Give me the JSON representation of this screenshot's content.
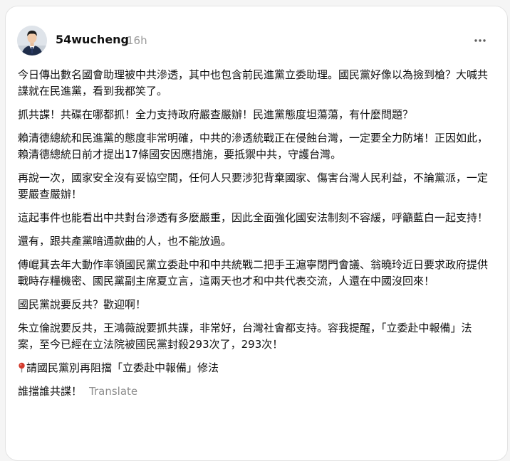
{
  "post": {
    "username": "54wucheng",
    "time": "16h",
    "paragraphs": [
      "今日傳出數名國會助理被中共滲透，其中也包含前民進黨立委助理。國民黨好像以為撿到槍？大喊共諜就在民進黨，看到我都笑了。",
      "抓共諜！共碟在哪都抓！全力支持政府嚴查嚴辦！民進黨態度坦蕩蕩，有什麼問題？",
      "賴清德總統和民進黨的態度非常明確，中共的滲透統戰正在侵蝕台灣，一定要全力防堵！正因如此，賴清德總統日前才提出17條國安因應措施，要抵禦中共，守護台灣。",
      "再說一次，國家安全沒有妥協空間，任何人只要涉犯背棄國家、傷害台灣人民利益，不論黨派，一定要嚴查嚴辦！",
      "這起事件也能看出中共對台滲透有多麼嚴重，因此全面強化國安法制刻不容緩，呼籲藍白一起支持！",
      "還有，跟共產黨暗通款曲的人，也不能放過。",
      "傅崐萁去年大動作率領國民黨立委赴中和中共統戰二把手王滬寧閉門會議、翁曉玲近日要求政府提供戰時存糧機密、國民黨副主席夏立言，這兩天也才和中共代表交流，人還在中國沒回來！",
      "國民黨說要反共？歡迎啊！",
      "朱立倫說要反共，王鴻薇說要抓共諜，非常好，台灣社會都支持。容我提醒，「立委赴中報備」法案，至今已經在立法院被國民黨封殺293次了，293次！"
    ],
    "pin_paragraph": "請國民黨別再阻擋「立委赴中報備」修法",
    "last_line": "誰擋誰共諜！",
    "translate_label": "Translate"
  },
  "icons": {
    "more": "more-horizontal-icon",
    "pin": "round-pushpin-icon"
  },
  "colors": {
    "text": "#101010",
    "muted": "#9a9a9a",
    "pin": "#d33a2c"
  }
}
